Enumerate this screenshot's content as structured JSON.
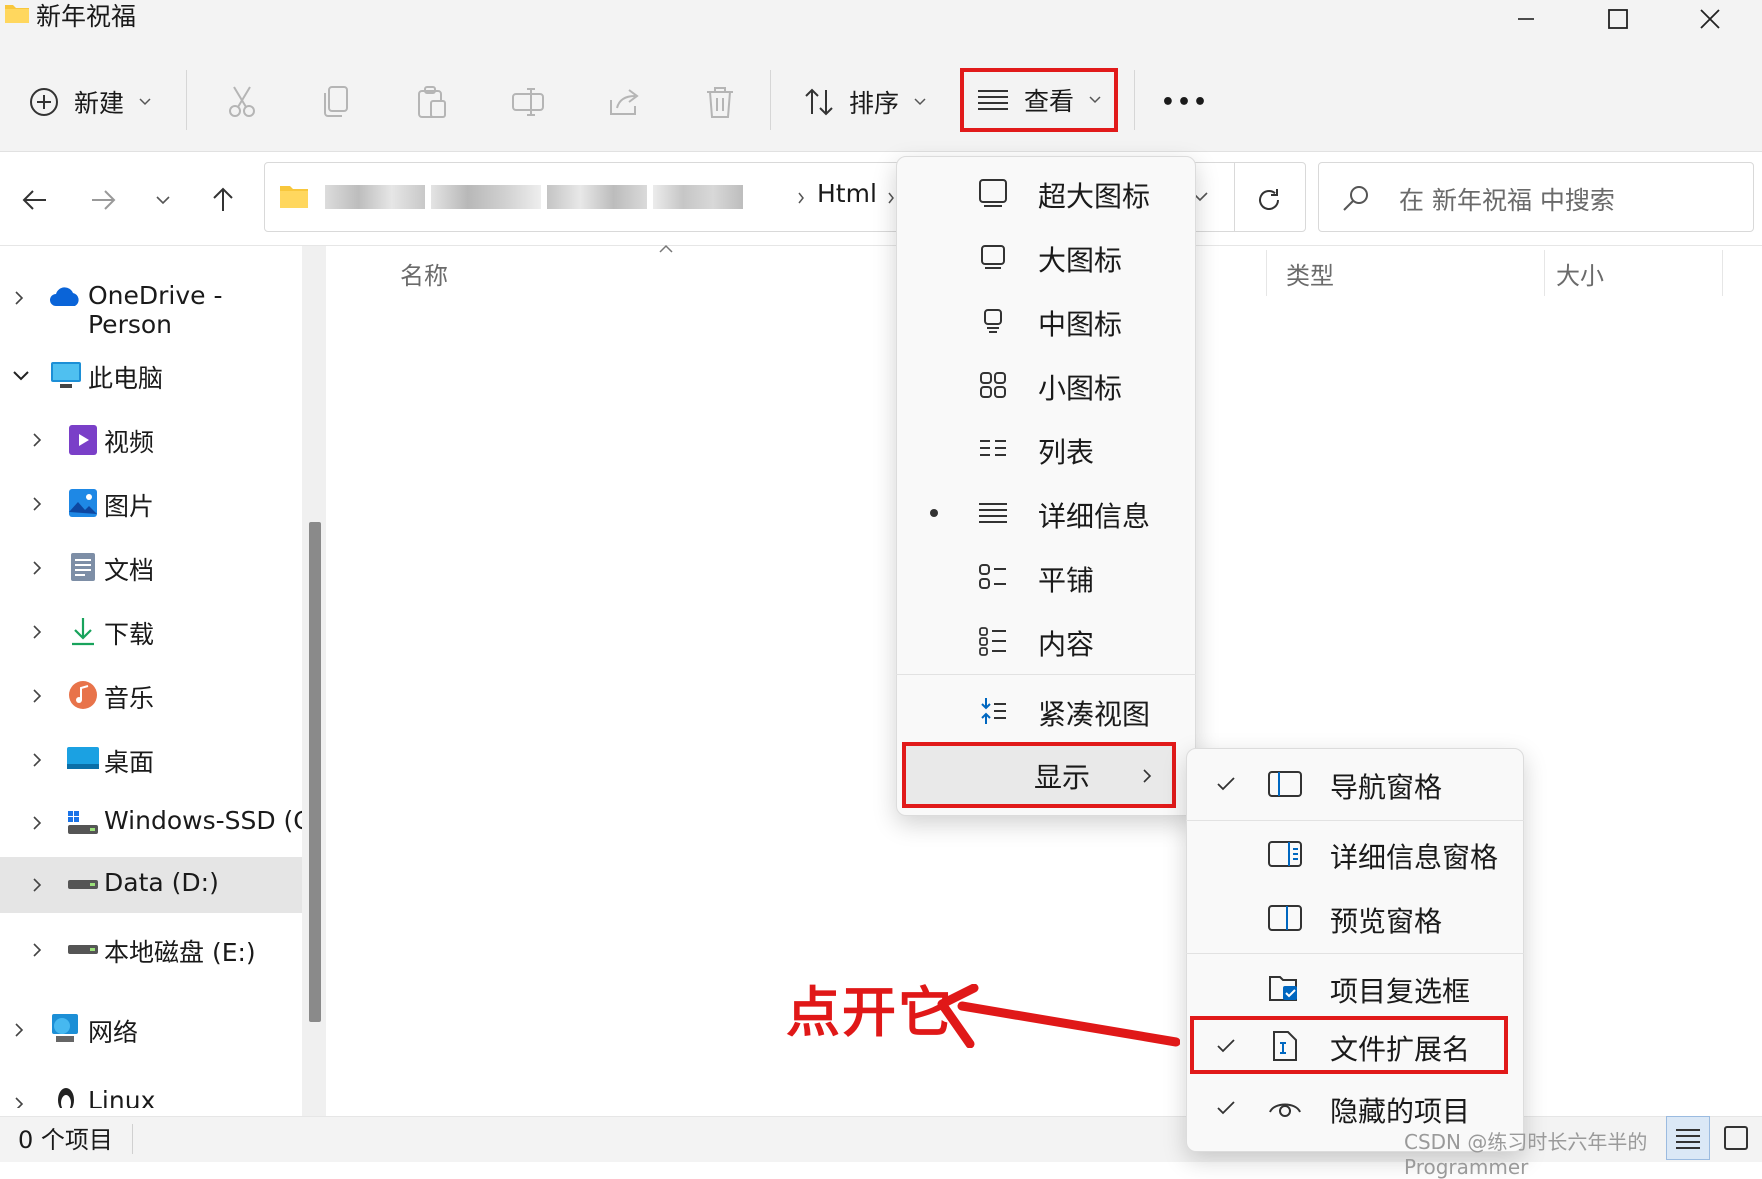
{
  "window": {
    "title": "新年祝福"
  },
  "toolbar": {
    "new_label": "新建",
    "sort_label": "排序",
    "view_label": "查看",
    "more_label": "•••"
  },
  "address": {
    "last_crumb": "Html",
    "search_placeholder": "在 新年祝福 中搜索"
  },
  "sidebar": {
    "items": [
      {
        "label": "OneDrive - Person"
      },
      {
        "label": "此电脑"
      },
      {
        "label": "视频"
      },
      {
        "label": "图片"
      },
      {
        "label": "文档"
      },
      {
        "label": "下载"
      },
      {
        "label": "音乐"
      },
      {
        "label": "桌面"
      },
      {
        "label": "Windows-SSD (C:"
      },
      {
        "label": "Data (D:)"
      },
      {
        "label": "本地磁盘 (E:)"
      },
      {
        "label": "网络"
      },
      {
        "label": "Linux"
      }
    ]
  },
  "columns": {
    "name": "名称",
    "type": "类型",
    "size": "大小"
  },
  "status": {
    "count": "0 个项目"
  },
  "view_menu": {
    "items": [
      {
        "label": "超大图标"
      },
      {
        "label": "大图标"
      },
      {
        "label": "中图标"
      },
      {
        "label": "小图标"
      },
      {
        "label": "列表"
      },
      {
        "label": "详细信息"
      },
      {
        "label": "平铺"
      },
      {
        "label": "内容"
      },
      {
        "label": "紧凑视图"
      },
      {
        "label": "显示"
      }
    ],
    "selected": "详细信息"
  },
  "show_menu": {
    "items": [
      {
        "label": "导航窗格",
        "checked": true
      },
      {
        "label": "详细信息窗格",
        "checked": false
      },
      {
        "label": "预览窗格",
        "checked": false
      },
      {
        "label": "项目复选框",
        "checked": false
      },
      {
        "label": "文件扩展名",
        "checked": true
      },
      {
        "label": "隐藏的项目",
        "checked": true
      }
    ]
  },
  "annotation": {
    "text": "点开它"
  },
  "watermark": {
    "text": "CSDN @练习时长六年半的Programmer"
  },
  "colors": {
    "highlight_red": "#e11a1a",
    "accent_blue": "#0067c0"
  }
}
